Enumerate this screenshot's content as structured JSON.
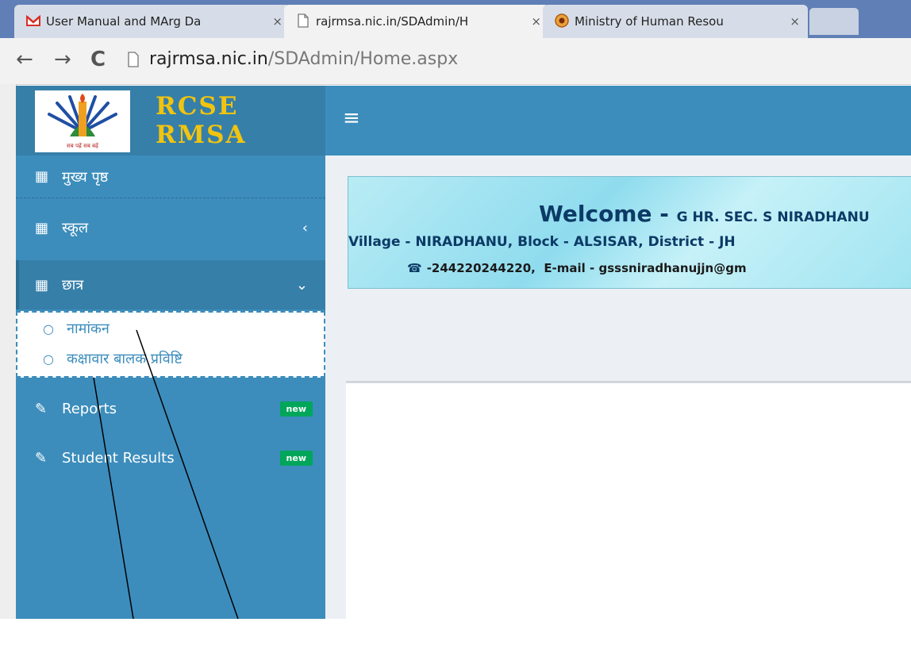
{
  "browser": {
    "tabs": [
      {
        "title": "User Manual and MArg Da",
        "close": "×",
        "icon": "gmail-icon"
      },
      {
        "title": "rajrmsa.nic.in/SDAdmin/H",
        "close": "×",
        "icon": "page-icon"
      },
      {
        "title": "Ministry of Human Resou",
        "close": "×",
        "icon": "emblem-icon"
      }
    ],
    "nav": {
      "back": "←",
      "forward": "→",
      "reload": "C"
    },
    "address": {
      "host": "rajrmsa.nic.in",
      "path": "/SDAdmin/Home.aspx"
    }
  },
  "header": {
    "logo_line1": "RCSE",
    "logo_line2": "RMSA",
    "menu_icon": "≡",
    "brand_color": "#3c8dbc"
  },
  "sidebar": {
    "items": [
      {
        "label": "मुख्य पृष्ठ",
        "icon": "grid-icon"
      },
      {
        "label": "स्कूल",
        "icon": "grid-icon",
        "arrow": "‹"
      },
      {
        "label": "छात्र",
        "icon": "grid-icon",
        "arrow": "⌄"
      },
      {
        "label": "Reports",
        "icon": "edit-icon",
        "badge": "new"
      },
      {
        "label": "Student Results",
        "icon": "edit-icon",
        "badge": "new"
      }
    ],
    "submenu": [
      {
        "label": "नामांकन",
        "icon": "circle-icon"
      },
      {
        "label": "कक्षावार बालक प्रविष्टि",
        "icon": "circle-icon"
      }
    ]
  },
  "welcome": {
    "prefix": "Welcome - ",
    "school": "G HR. SEC. S NIRADHANU",
    "address": "Village - NIRADHANU, Block - ALSISAR, District - JH",
    "phone": "-244220244220,",
    "email": "E-mail - gsssniradhanujjn@gm"
  }
}
